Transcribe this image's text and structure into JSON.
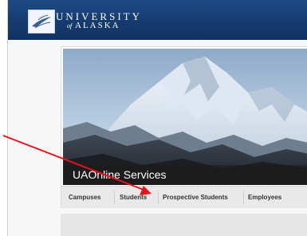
{
  "header": {
    "logo_line1": "UNIVERSITY",
    "logo_of": "of",
    "logo_line2": "ALASKA",
    "logo_icon": "raven-icon"
  },
  "hero": {
    "banner_title": "UAOnline Services"
  },
  "tabs": [
    {
      "label": "Campuses"
    },
    {
      "label": "Students"
    },
    {
      "label": "Prospective Students"
    },
    {
      "label": "Employees"
    }
  ],
  "annotation": {
    "icon": "red-arrow-icon",
    "color": "#e8121b"
  },
  "colors": {
    "header_blue": "#1a4580",
    "tab_bar": "#e9e9e9"
  }
}
